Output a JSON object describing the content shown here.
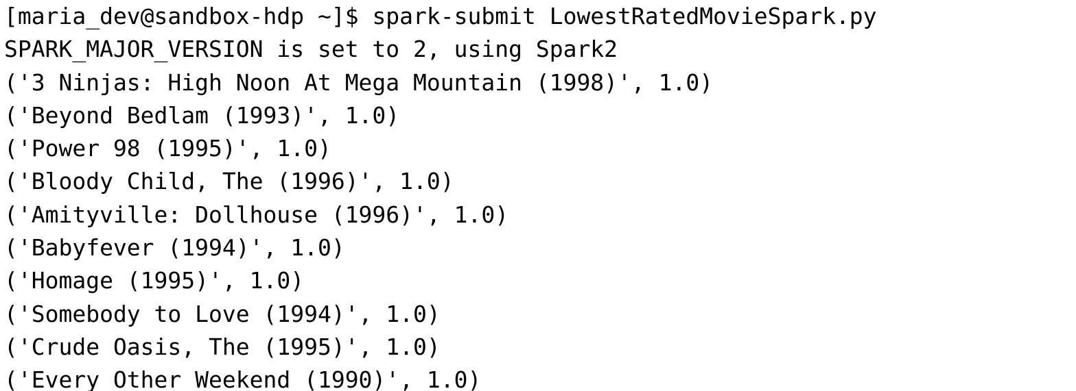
{
  "terminal": {
    "prompt": "[maria_dev@sandbox-hdp ~]$ ",
    "command": "spark-submit LowestRatedMovieSpark.py",
    "output_lines": [
      "SPARK_MAJOR_VERSION is set to 2, using Spark2",
      "('3 Ninjas: High Noon At Mega Mountain (1998)', 1.0)",
      "('Beyond Bedlam (1993)', 1.0)",
      "('Power 98 (1995)', 1.0)",
      "('Bloody Child, The (1996)', 1.0)",
      "('Amityville: Dollhouse (1996)', 1.0)",
      "('Babyfever (1994)', 1.0)",
      "('Homage (1995)', 1.0)",
      "('Somebody to Love (1994)', 1.0)",
      "('Crude Oasis, The (1995)', 1.0)",
      "('Every Other Weekend (1990)', 1.0)"
    ]
  },
  "colors": {
    "background": "#ffffff",
    "text": "#000000"
  }
}
